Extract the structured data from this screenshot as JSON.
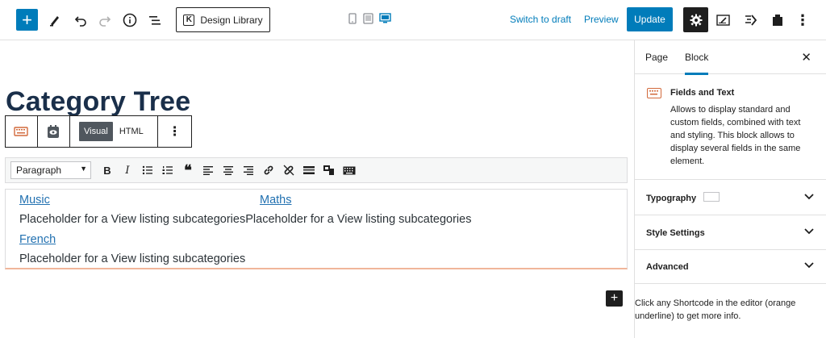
{
  "toolbar": {
    "add_label": "+",
    "design_library_label": "Design Library",
    "switch_to_draft": "Switch to draft",
    "preview": "Preview",
    "update": "Update",
    "more": "⋮"
  },
  "editor": {
    "post_title": "Category Tree",
    "block_toolbar": {
      "visual": "Visual",
      "html": "HTML",
      "more": "⋮"
    },
    "format_select": "Paragraph",
    "content": {
      "row1": {
        "link_a": "Music",
        "link_b": "Maths"
      },
      "row2": {
        "text_a": "Placeholder for a View listing subcategories",
        "text_b": "Placeholder for a View listing subcategories"
      },
      "row3": {
        "link": "French"
      },
      "row4": {
        "text": "Placeholder for a View listing subcategories"
      }
    },
    "inserter_label": "+"
  },
  "sidebar": {
    "tabs": [
      {
        "label": "Page"
      },
      {
        "label": "Block"
      }
    ],
    "close": "✕",
    "block": {
      "title": "Fields and Text",
      "description": "Allows to display standard and custom fields, combined with text and styling. This block allows to display several fields in the same element."
    },
    "panels": [
      {
        "label": "Typography"
      },
      {
        "label": "Style Settings"
      },
      {
        "label": "Advanced"
      }
    ],
    "hint": "Click any Shortcode in the editor (orange underline) to get more info."
  },
  "colors": {
    "accent": "#007cba",
    "link": "#2271b1",
    "title": "#1a2f4a",
    "underline": "#f0b69a"
  }
}
